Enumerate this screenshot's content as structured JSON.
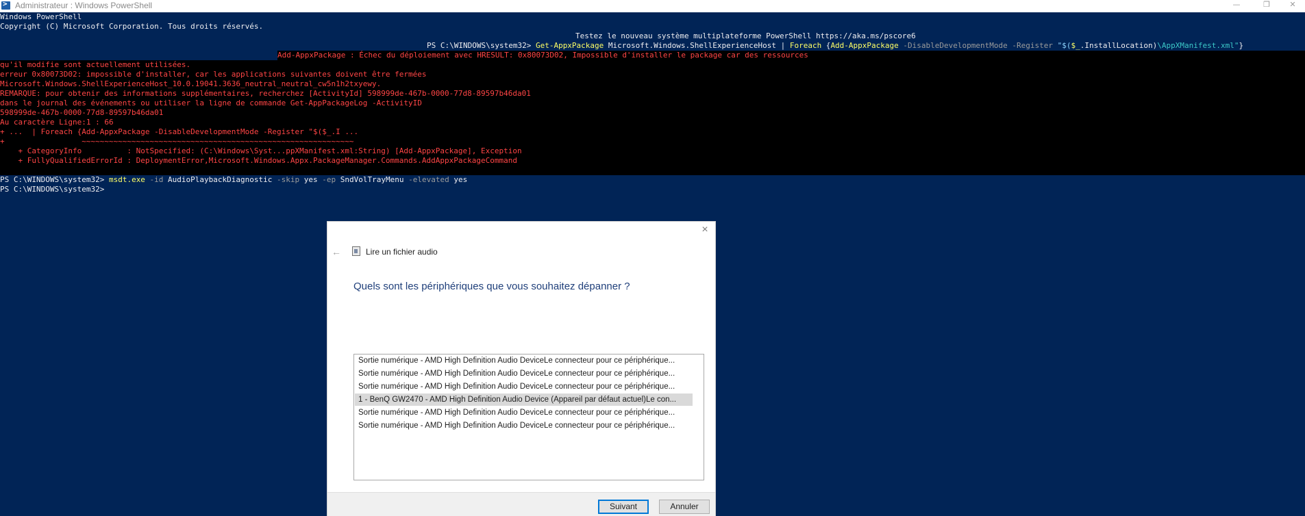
{
  "window": {
    "title": "Administrateur : Windows PowerShell",
    "minimize": "—",
    "maximize": "❐",
    "close": "✕"
  },
  "console": {
    "banner1": "Windows PowerShell",
    "banner2": "Copyright (C) Microsoft Corporation. Tous droits réservés.",
    "banner3": "Testez le nouveau système multiplateforme PowerShell https://aka.ms/pscore6",
    "cmd1": {
      "prompt": "PS C:\\WINDOWS\\system32> ",
      "p1": "Get-AppxPackage",
      "p2": " Microsoft.Windows.ShellExperienceHost | ",
      "p3": "Foreach",
      "p4": " {",
      "p5": "Add-AppxPackage",
      "p6": " -DisableDevelopmentMode -Register ",
      "p7": "\"$(",
      "p8": "$_",
      "p9": ".InstallLocation)",
      "p10": "\\AppXManifest.xml\"",
      "p11": "}"
    },
    "errors": [
      "Add-AppxPackage : Échec du déploiement avec HRESULT: 0x80073D02, Impossible d'installer le package car des ressources",
      "qu'il modifie sont actuellement utilisées.",
      "erreur 0x80073D02: impossible d'installer, car les applications suivantes doivent être fermées",
      "Microsoft.Windows.ShellExperienceHost_10.0.19041.3636_neutral_neutral_cw5n1h2txyewy.",
      "REMARQUE: pour obtenir des informations supplémentaires, recherchez [ActivityId] 598999de-467b-0000-77d8-89597b46da01",
      "dans le journal des événements ou utiliser la ligne de commande Get-AppPackageLog -ActivityID",
      "598999de-467b-0000-77d8-89597b46da01",
      "Au caractère Ligne:1 : 66",
      "+ ...  | Foreach {Add-AppxPackage -DisableDevelopmentMode -Register \"$($_.I ...",
      "+                 ~~~~~~~~~~~~~~~~~~~~~~~~~~~~~~~~~~~~~~~~~~~~~~~~~~~~~~~~~~~~",
      "    + CategoryInfo          : NotSpecified: (C:\\Windows\\Syst...ppXManifest.xml:String) [Add-AppxPackage], Exception",
      "    + FullyQualifiedErrorId : DeploymentError,Microsoft.Windows.Appx.PackageManager.Commands.AddAppxPackageCommand"
    ],
    "cmd2": {
      "prompt": "PS C:\\WINDOWS\\system32> ",
      "exe": "msdt.exe",
      "a1": " -id",
      "a2": " AudioPlaybackDiagnostic",
      "a3": " -skip",
      "a4": " yes",
      "a5": " -ep",
      "a6": " SndVolTrayMenu",
      "a7": " -elevated",
      "a8": " yes"
    },
    "prompt3": "PS C:\\WINDOWS\\system32>"
  },
  "dialog": {
    "app_title": "Lire un fichier audio",
    "heading": "Quels sont les périphériques que vous souhaitez dépanner ?",
    "devices": [
      "Sortie numérique - AMD High Definition Audio DeviceLe connecteur pour ce périphérique...",
      "Sortie numérique - AMD High Definition Audio DeviceLe connecteur pour ce périphérique...",
      "Sortie numérique - AMD High Definition Audio DeviceLe connecteur pour ce périphérique...",
      "1 - BenQ GW2470 - AMD High Definition Audio Device (Appareil par défaut actuel)Le con...",
      "Sortie numérique - AMD High Definition Audio DeviceLe connecteur pour ce périphérique...",
      "Sortie numérique - AMD High Definition Audio DeviceLe connecteur pour ce périphérique..."
    ],
    "selected_index": 3,
    "next_label": "Suivant",
    "cancel_label": "Annuler",
    "close_glyph": "×",
    "back_glyph": "←"
  }
}
